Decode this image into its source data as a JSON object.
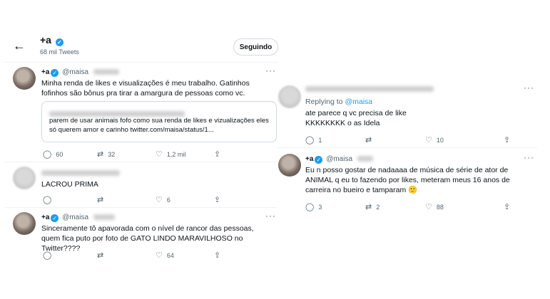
{
  "left": {
    "header": {
      "back_icon": "←",
      "name": "+a",
      "subtitle": "68 mil Tweets",
      "follow_label": "Seguindo"
    },
    "tweet1": {
      "name": "+a",
      "handle": "@maisa",
      "text": "Minha renda de likes e visualizações é meu trabalho. Gatinhos fofinhos são bônus  pra tirar a amargura de pessoas como vc.",
      "quote_text": "parem de usar animais fofo como sua renda de likes e vizualizações eles só querem amor e carinho ",
      "quote_link": "twitter.com/maisa/status/1...",
      "replies": "60",
      "retweets": "32",
      "likes": "1,2 mil"
    },
    "reply1": {
      "text": "LACROU PRIMA",
      "retweets": "",
      "likes": "6"
    },
    "tweet2": {
      "name": "+a",
      "handle": "@maisa",
      "text": "Sinceramente tô apavorada com o nível de rancor das pessoas, quem fica puto por foto de GATO LINDO MARAVILHOSO no Twitter????",
      "likes": "64"
    }
  },
  "right": {
    "reply": {
      "replying_prefix": "Replying to ",
      "replying_handle": "@maisa",
      "line1": "ate parece q vc precisa de like",
      "line2": "KKKKKKKK o as Idela",
      "replies": "1",
      "likes": "10"
    },
    "tweet": {
      "name": "+a",
      "handle": "@maisa",
      "text": "Eu n posso gostar de nadaaaa de música de série de ator de ANIMAL q eu to fazendo por likes, meteram meus 16 anos de carreira no bueiro e tamparam 🙂",
      "replies": "3",
      "retweets": "2",
      "likes": "88"
    }
  },
  "icons": {
    "verified": "✓",
    "more": "···",
    "reply": "◯",
    "retweet": "⇄",
    "like": "♡",
    "share": "⇪"
  }
}
